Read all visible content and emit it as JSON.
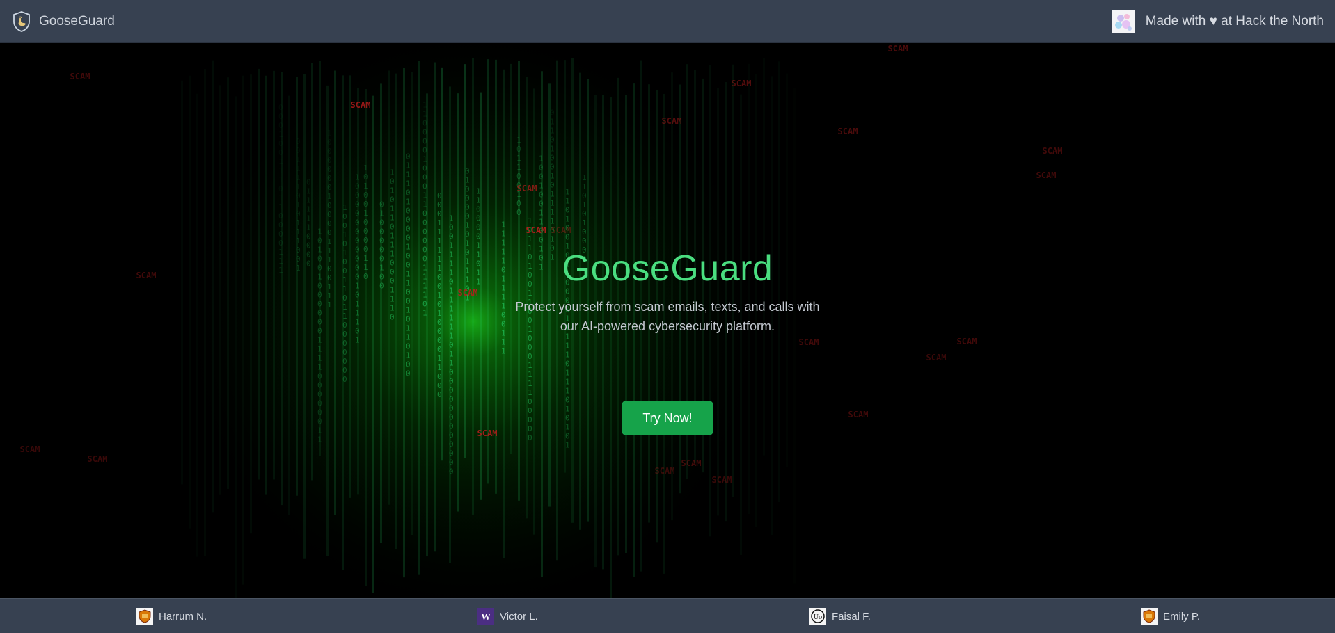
{
  "header": {
    "brand_name": "GooseGuard",
    "brand_icon": "goose-shield-icon",
    "credit_text": "Made with ♥ at Hack the North",
    "credit_icon": "hack-the-north-logo"
  },
  "hero": {
    "title": "GooseGuard",
    "subtitle_line1": "Protect yourself from scam emails, texts, and calls with",
    "subtitle_line2": "our AI-powered cybersecurity platform.",
    "cta_label": "Try Now!",
    "background_word": "SCAM",
    "colors": {
      "title": "#4ade80",
      "cta": "#16a34a",
      "matrix_green": "#22c55e",
      "scam_red": "#b91c1c"
    }
  },
  "footer": {
    "members": [
      {
        "name": "Harrum N.",
        "badge_icon": "university-crest-icon"
      },
      {
        "name": "Victor L.",
        "badge_icon": "w-logo-icon"
      },
      {
        "name": "Faisal F.",
        "badge_icon": "uo-logo-icon"
      },
      {
        "name": "Emily P.",
        "badge_icon": "university-crest-icon"
      }
    ]
  }
}
